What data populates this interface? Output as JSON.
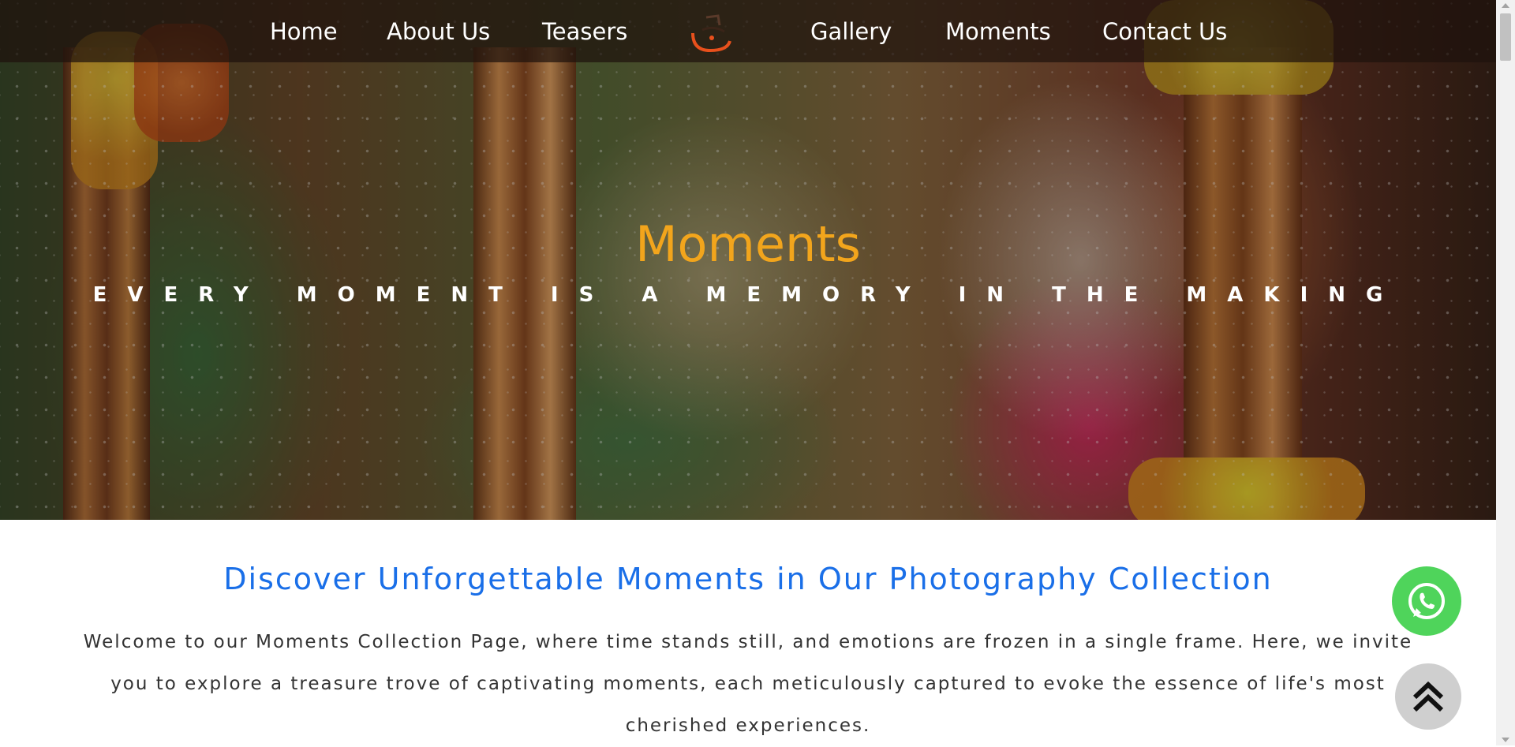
{
  "navbar": {
    "items": [
      {
        "label": "Home"
      },
      {
        "label": "About Us"
      },
      {
        "label": "Teasers"
      },
      {
        "label": "Gallery"
      },
      {
        "label": "Moments"
      },
      {
        "label": "Contact Us"
      }
    ],
    "logo_icon": "studio-logo-icon"
  },
  "hero": {
    "title": "Moments",
    "subtitle": "EVERY MOMENT IS A MEMORY IN THE MAKING",
    "image": "couple-portrait-photo"
  },
  "content": {
    "heading": "Discover Unforgettable Moments in Our Photography Collection",
    "body": "Welcome to our Moments Collection Page, where time stands still, and emotions are frozen in a single frame. Here, we invite you to explore a treasure trove of captivating moments, each meticulously captured to evoke the essence of life's most cherished experiences."
  },
  "floating": {
    "whatsapp_icon": "whatsapp-icon",
    "scroll_top_icon": "double-chevron-up-icon"
  },
  "colors": {
    "accent_title": "#f2a51c",
    "heading_blue": "#1a6fe8",
    "whatsapp_green": "#4fd45b"
  }
}
